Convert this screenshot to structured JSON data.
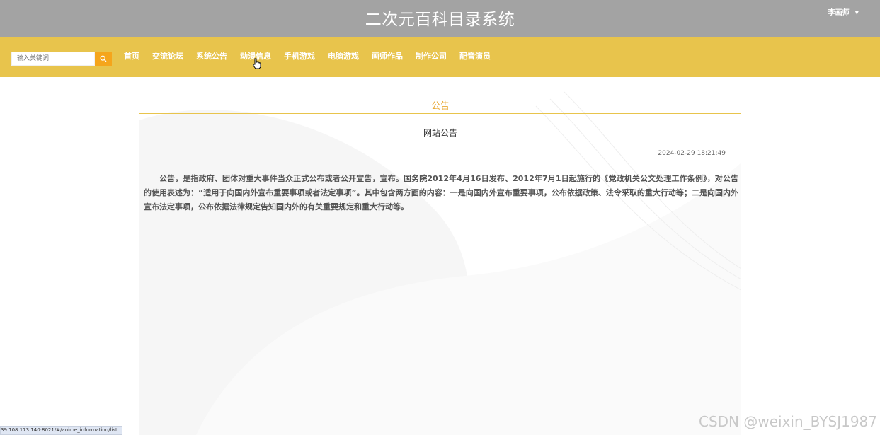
{
  "header": {
    "title": "二次元百科目录系统",
    "user_name": "李画师",
    "user_caret": "▼"
  },
  "navbar": {
    "search_placeholder": "输入关键词",
    "items": [
      {
        "label": "首页"
      },
      {
        "label": "交流论坛"
      },
      {
        "label": "系统公告"
      },
      {
        "label": "动漫信息"
      },
      {
        "label": "手机游戏"
      },
      {
        "label": "电脑游戏"
      },
      {
        "label": "画师作品"
      },
      {
        "label": "制作公司"
      },
      {
        "label": "配音演员"
      }
    ]
  },
  "content": {
    "section_title": "公告",
    "article_title": "网站公告",
    "article_time": "2024-02-29 18:21:49",
    "article_body": "公告，是指政府、团体对重大事件当众正式公布或者公开宣告，宣布。国务院2012年4月16日发布、2012年7月1日起施行的《党政机关公文处理工作条例》，对公告的使用表述为：“适用于向国内外宣布重要事项或者法定事项”。其中包含两方面的内容：一是向国内外宣布重要事项，公布依据政策、法令采取的重大行动等；二是向国内外宣布法定事项，公布依据法律规定告知国内外的有关重要规定和重大行动等。"
  },
  "status_bar": {
    "url": "39.108.173.140:8021/#/anime_information/list"
  },
  "watermark": "CSDN @weixin_BYSJ1987",
  "colors": {
    "header_bg": "#a3a3a3",
    "navbar_bg": "#e8c44c",
    "search_button": "#f5a51b",
    "section_title": "#e8a833"
  }
}
